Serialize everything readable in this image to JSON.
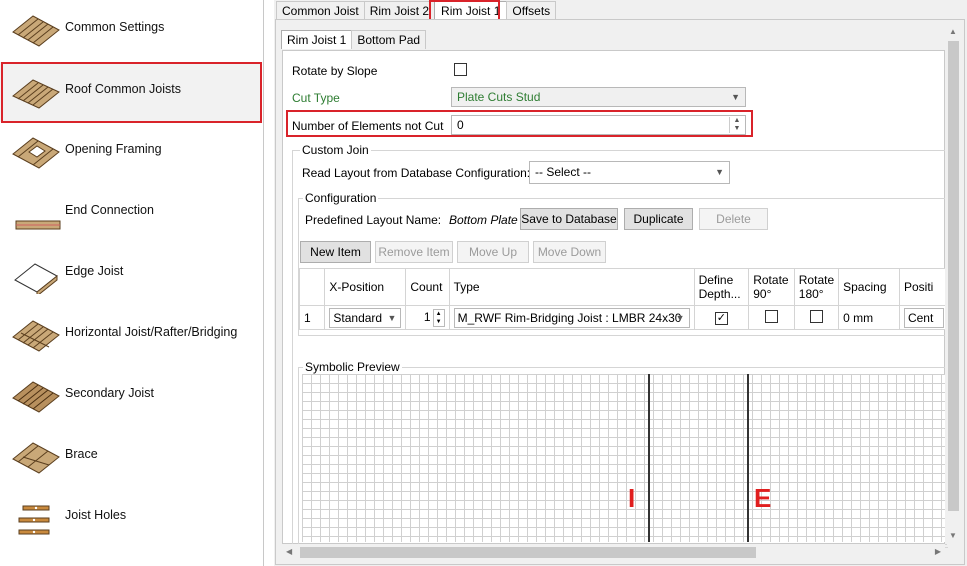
{
  "sidebar": {
    "items": [
      {
        "label": "Common Settings",
        "icon": "joist-icon"
      },
      {
        "label": "Roof Common Joists",
        "icon": "roof-joist-icon",
        "selected": true
      },
      {
        "label": "Opening Framing",
        "icon": "opening-icon"
      },
      {
        "label": "End Connection",
        "icon": "end-connection-icon"
      },
      {
        "label": "Edge Joist",
        "icon": "edge-joist-icon"
      },
      {
        "label": "Horizontal Joist/Rafter/Bridging",
        "icon": "horizontal-joist-icon"
      },
      {
        "label": "Secondary Joist",
        "icon": "secondary-joist-icon"
      },
      {
        "label": "Brace",
        "icon": "brace-icon"
      },
      {
        "label": "Joist Holes",
        "icon": "joist-holes-icon"
      }
    ]
  },
  "top_tabs": [
    "Common Joist",
    "Rim Joist 2",
    "Rim Joist 1",
    "Offsets"
  ],
  "sub_tabs": [
    "Rim Joist 1",
    "Bottom Pad"
  ],
  "form": {
    "rotate_by_slope": "Rotate by Slope",
    "cut_type_label": "Cut Type",
    "cut_type_value": "Plate Cuts Stud",
    "num_elements_label": "Number of Elements not Cut",
    "num_elements_value": "0"
  },
  "custom_join": {
    "title": "Custom Join",
    "read_layout_label": "Read Layout from Database Configuration:",
    "read_layout_value": "-- Select --"
  },
  "configuration": {
    "title": "Configuration",
    "predefined_label": "Predefined Layout Name:",
    "predefined_value": "Bottom Plate",
    "save_db": "Save to Database",
    "duplicate": "Duplicate",
    "delete": "Delete",
    "new_item": "New Item",
    "remove_item": "Remove Item",
    "move_up": "Move Up",
    "move_down": "Move Down"
  },
  "table": {
    "headers": [
      "X-Position",
      "Count",
      "Type",
      "Define Depth...",
      "Rotate 90°",
      "Rotate 180°",
      "Spacing",
      "Positi"
    ],
    "rows": [
      {
        "index": "1",
        "x_position": "Standard",
        "count": "1",
        "type": "M_RWF Rim-Bridging Joist : LMBR 24x30",
        "define_depth": true,
        "rotate90": false,
        "rotate180": false,
        "spacing": "0 mm",
        "position": "Cent"
      }
    ]
  },
  "preview": {
    "title": "Symbolic Preview",
    "marker_i": "I",
    "marker_e": "E"
  },
  "colors": {
    "highlight": "#d9232a",
    "marker": "#e01e1e",
    "green": "#2e7d32"
  }
}
